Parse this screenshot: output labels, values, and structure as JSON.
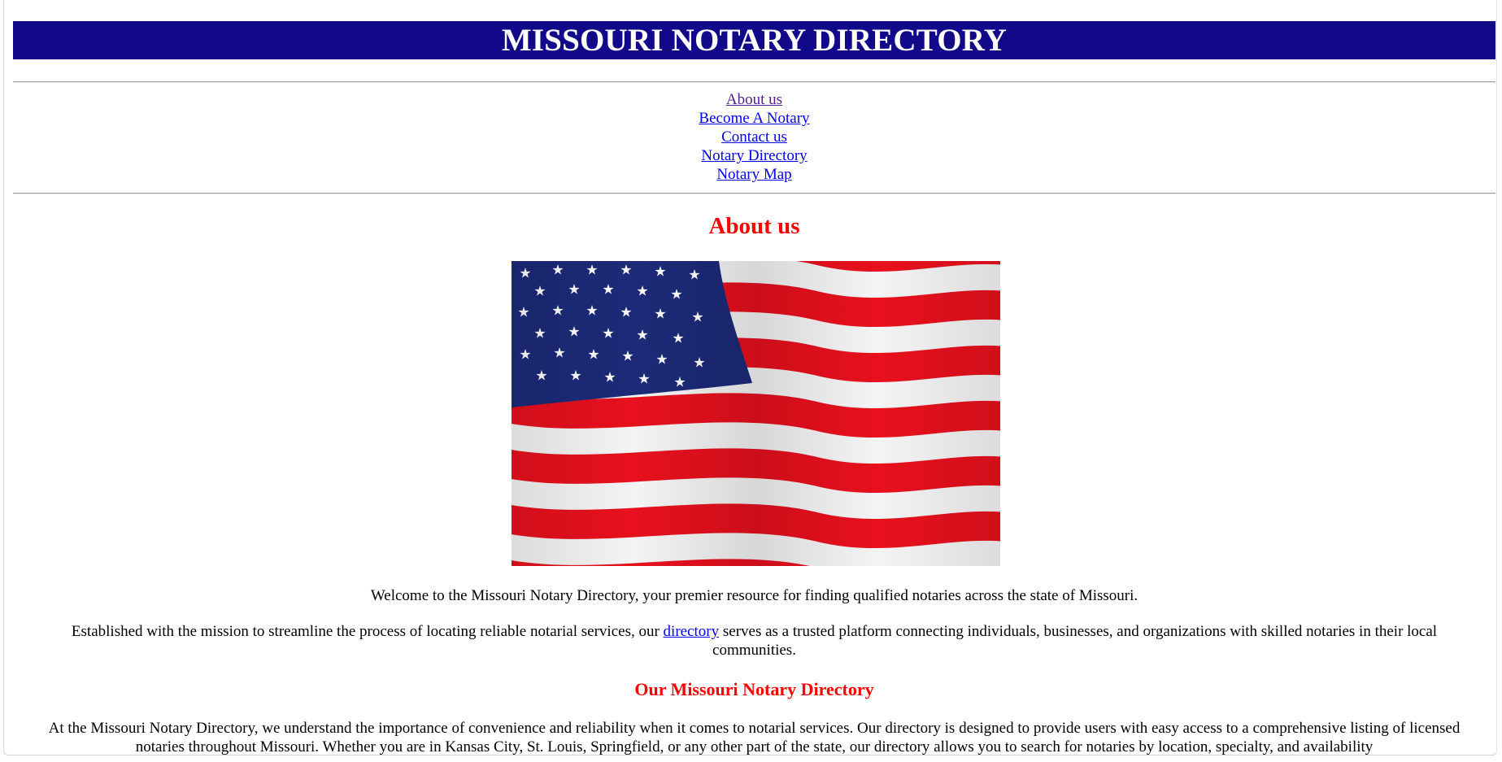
{
  "header": {
    "title": "MISSOURI NOTARY DIRECTORY"
  },
  "nav": {
    "items": [
      {
        "label": "About us",
        "state": "visited"
      },
      {
        "label": "Become A Notary"
      },
      {
        "label": "Contact us"
      },
      {
        "label": "Notary Directory"
      },
      {
        "label": "Notary Map"
      }
    ]
  },
  "main": {
    "heading": "About us",
    "image": {
      "subject": "american-flag"
    },
    "intro": "Welcome to the Missouri Notary Directory, your premier resource for finding qualified notaries across the state of Missouri.",
    "mission": {
      "before": "Established with the mission to streamline the process of locating reliable notarial services, our ",
      "link": "directory",
      "after": " serves as a trusted platform connecting individuals, businesses, and organizations with skilled notaries in their local communities."
    },
    "subheading": "Our Missouri Notary Directory",
    "body": "At the Missouri Notary Directory, we understand the importance of convenience and reliability when it comes to notarial services. Our directory is designed to provide users with easy access to a comprehensive listing of licensed notaries throughout Missouri. Whether you are in Kansas City, St. Louis, Springfield, or any other part of the state, our directory allows you to search for notaries by location, specialty, and availability"
  },
  "colors": {
    "banner": "#11088a",
    "heading": "#ff0000",
    "link": "#0000ee",
    "visited_link": "#551a8b"
  }
}
